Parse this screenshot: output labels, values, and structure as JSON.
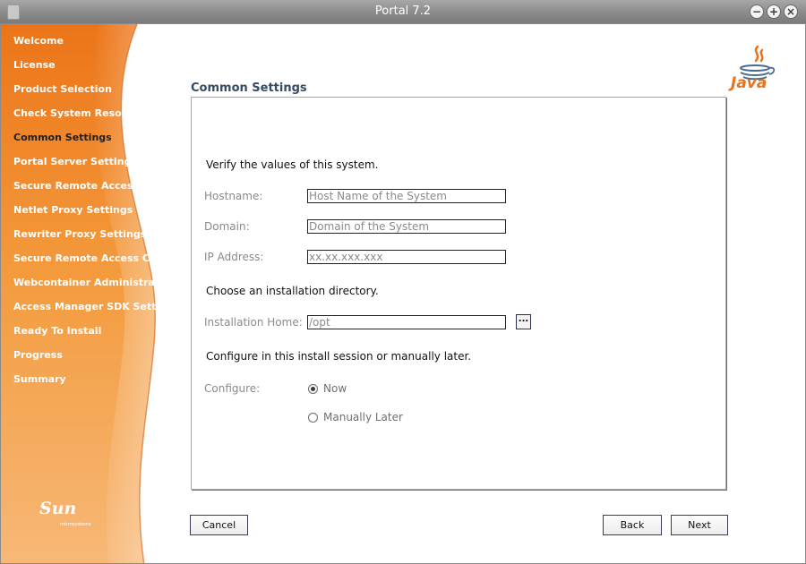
{
  "window": {
    "title": "Portal 7.2"
  },
  "colors": {
    "sidebar_orange": "#f08a28",
    "title_blue": "#344b64",
    "java_orange": "#e8731a"
  },
  "sidebar": {
    "items": [
      {
        "label": "Welcome"
      },
      {
        "label": "License"
      },
      {
        "label": "Product Selection"
      },
      {
        "label": "Check System Resources"
      },
      {
        "label": "Common Settings",
        "current": true
      },
      {
        "label": "Portal Server Settings"
      },
      {
        "label": "Secure Remote Access Settings"
      },
      {
        "label": "Netlet Proxy Settings"
      },
      {
        "label": "Rewriter Proxy Settings"
      },
      {
        "label": "Secure Remote Access Core"
      },
      {
        "label": "Webcontainer Administration"
      },
      {
        "label": "Access Manager SDK Settings"
      },
      {
        "label": "Ready To Install"
      },
      {
        "label": "Progress"
      },
      {
        "label": "Summary"
      }
    ],
    "logo": {
      "text": "Sun",
      "subtext": "microsystems"
    }
  },
  "brand": {
    "java_text": "Java"
  },
  "main": {
    "title": "Common Settings",
    "verify_text": "Verify the values of this system.",
    "hostname": {
      "label": "Hostname:",
      "value": "Host Name of the System"
    },
    "domain": {
      "label": "Domain:",
      "value": "Domain of the System"
    },
    "ip": {
      "label": "IP Address:",
      "value": "xx.xx.xxx.xxx"
    },
    "dir_text": "Choose an installation directory.",
    "install_home": {
      "label": "Installation Home:",
      "value": "/opt",
      "browse_label": "..."
    },
    "configure_text": "Configure in this install session or manually later.",
    "configure": {
      "label": "Configure:",
      "options": [
        {
          "label": "Now",
          "selected": true
        },
        {
          "label": "Manually Later",
          "selected": false
        }
      ]
    }
  },
  "buttons": {
    "cancel": "Cancel",
    "back": "Back",
    "next": "Next"
  }
}
